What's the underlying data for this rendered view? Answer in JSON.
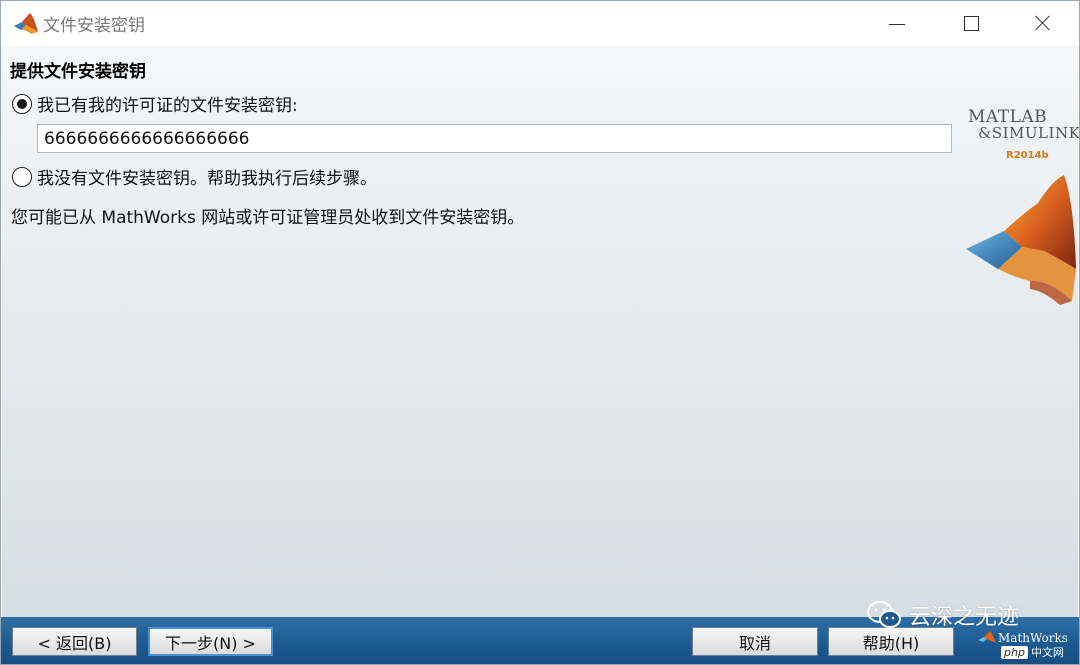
{
  "window": {
    "title": "文件安装密钥"
  },
  "page": {
    "section_title": "提供文件安装密钥",
    "option_have_key": {
      "label": "我已有我的许可证的文件安装密钥:",
      "selected": true
    },
    "key_input": {
      "value": "6666666666666666666"
    },
    "option_no_key": {
      "label": "我没有文件安装密钥。帮助我执行后续步骤。",
      "selected": false
    },
    "info_text": "您可能已从 MathWorks 网站或许可证管理员处收到文件安装密钥。"
  },
  "branding": {
    "product_line1": "MATLAB",
    "product_line2": "&SIMULINK",
    "version": "R2014b",
    "company": "MathWorks"
  },
  "buttons": {
    "back": "< 返回(B)",
    "next": "下一步(N) >",
    "cancel": "取消",
    "help": "帮助(H)"
  },
  "watermark": {
    "text": "云深之无迹",
    "site_badge": "php",
    "site_cn": "中文网"
  },
  "colors": {
    "bottom_bar": "#1c5a92",
    "focus_border": "#4a90d9",
    "version_orange": "#d77a1e"
  }
}
